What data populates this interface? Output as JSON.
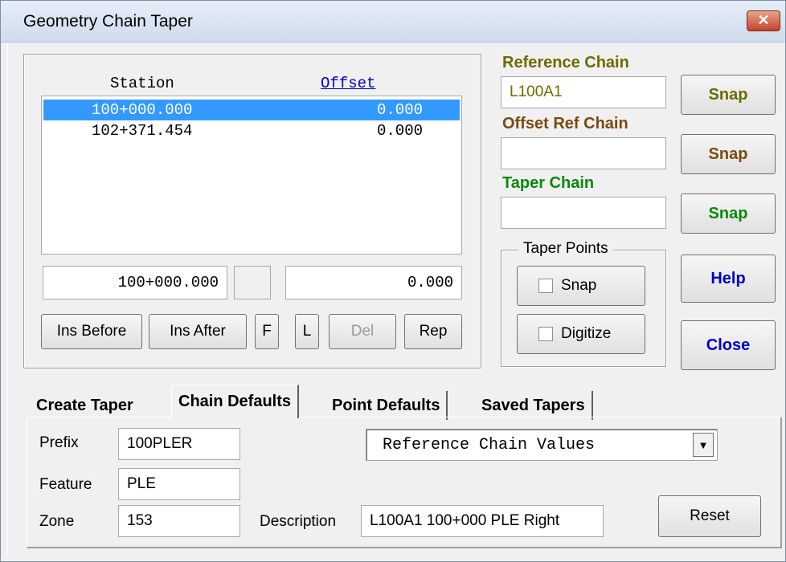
{
  "window": {
    "title": "Geometry Chain Taper",
    "close_glyph": "✕"
  },
  "station_list": {
    "col_station": "Station",
    "col_offset": "Offset",
    "rows": [
      {
        "station": "100+000.000",
        "offset": "0.000",
        "selected": true
      },
      {
        "station": "102+371.454",
        "offset": "0.000",
        "selected": false
      }
    ],
    "station_input": "100+000.000",
    "offset_input": "0.000",
    "middle_input": ""
  },
  "list_buttons": {
    "ins_before": "Ins Before",
    "ins_after": "Ins After",
    "first": "F",
    "last": "L",
    "del": "Del",
    "rep": "Rep"
  },
  "chains": {
    "reference_label": "Reference Chain",
    "reference_value": "L100A1",
    "offset_ref_label": "Offset Ref Chain",
    "offset_ref_value": "",
    "taper_label": "Taper Chain",
    "taper_value": "",
    "snap": "Snap",
    "colors": {
      "reference": "#6b6b00",
      "offset_ref": "#7a4a10",
      "taper": "#0a8a0a",
      "help_close": "#0000cc"
    }
  },
  "taper_points": {
    "group_label": "Taper Points",
    "snap": "Snap",
    "digitize": "Digitize"
  },
  "side_buttons": {
    "help": "Help",
    "close": "Close"
  },
  "tabs": {
    "create_taper": "Create Taper",
    "chain_defaults": "Chain Defaults",
    "point_defaults": "Point Defaults",
    "saved_tapers": "Saved Tapers"
  },
  "chain_defaults": {
    "prefix_label": "Prefix",
    "prefix_value": "100PLER",
    "feature_label": "Feature",
    "feature_value": "PLE",
    "zone_label": "Zone",
    "zone_value": "153",
    "description_label": "Description",
    "description_value": "L100A1 100+000 PLE Right",
    "values_dropdown": "Reference Chain Values",
    "reset": "Reset"
  }
}
